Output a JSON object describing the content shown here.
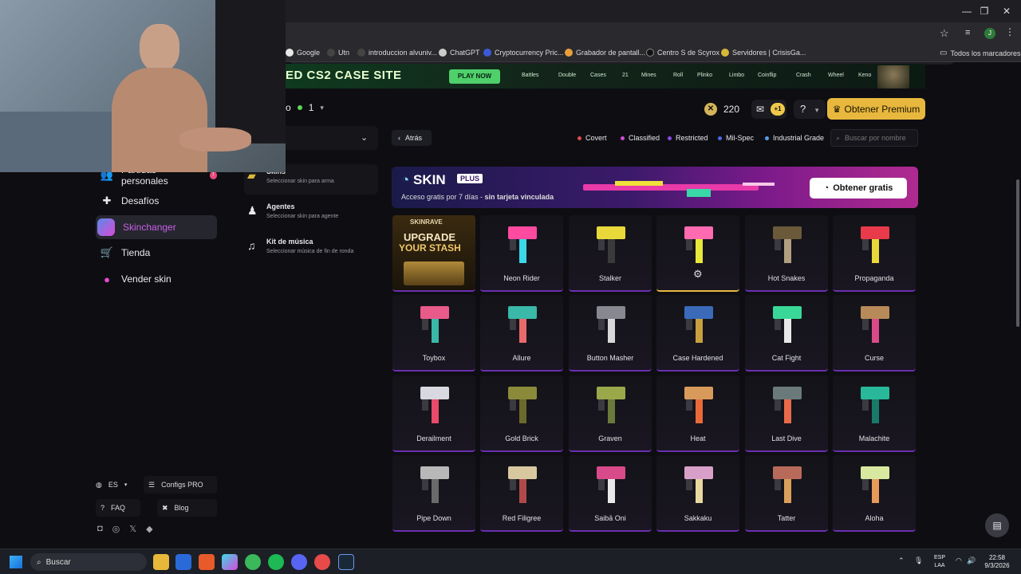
{
  "browser": {
    "bookmarks": [
      "Google",
      "Utn",
      "introduccion alvuniv...",
      "ChatGPT",
      "Cryptocurrency Pric...",
      "Grabador de pantall...",
      "Centro S de Scyrox",
      "Servidores | CrisisGa..."
    ],
    "all_bookmarks_label": "Todos los marcadores",
    "profile_initial": "J"
  },
  "promo_banner": {
    "title": "ED CS2 CASE SITE",
    "button": "PLAY NOW",
    "modes": [
      "Battles",
      "Double",
      "Cases",
      "21",
      "Mines",
      "Roll",
      "Plinko",
      "Limbo",
      "Coinflip",
      "Crash",
      "Wheel",
      "Keno"
    ]
  },
  "header": {
    "level_prefix": "o",
    "level": "1",
    "coins": "220",
    "inbox_badge": "+1",
    "help_label": "?",
    "premium_button": "Obtener Premium"
  },
  "sidebar": {
    "items": [
      {
        "label": "Partidas personales",
        "badge": "!"
      },
      {
        "label": "Desafíos"
      },
      {
        "label": "Skinchanger"
      },
      {
        "label": "Tienda"
      },
      {
        "label": "Vender skin"
      }
    ],
    "language": "ES",
    "configs": "Configs PRO",
    "faq": "FAQ",
    "blog": "Blog"
  },
  "subnav": {
    "items": [
      {
        "title": "Skins",
        "desc": "Seleccionar skin para arma"
      },
      {
        "title": "Agentes",
        "desc": "Seleccionar skin para agente"
      },
      {
        "title": "Kit de música",
        "desc": "Seleccionar música de fin de ronda"
      }
    ]
  },
  "filters": {
    "back": "Atrás",
    "rarities": [
      {
        "label": "Covert",
        "color": "#e04a4a"
      },
      {
        "label": "Classified",
        "color": "#d34ad8"
      },
      {
        "label": "Restricted",
        "color": "#8a4ae8"
      },
      {
        "label": "Mil-Spec",
        "color": "#4a6ae8"
      },
      {
        "label": "Industrial Grade",
        "color": "#5a9ae8"
      }
    ],
    "search_placeholder": "Buscar por nombre"
  },
  "skinplus": {
    "logo": "SKIN",
    "logo_badge": "PLUS",
    "text_a": "Acceso gratis por 7 días - ",
    "text_b": "sin tarjeta vinculada",
    "button": "Obtener gratis"
  },
  "ad_card": {
    "brand": "SKINRAVE",
    "line1": "UPGRADE",
    "line2": "YOUR STASH"
  },
  "skins": [
    {
      "name": "Neon Rider",
      "c1": "#ff4aa0",
      "c2": "#3ad8e8"
    },
    {
      "name": "Stalker",
      "c1": "#e8d83a",
      "c2": "#3a3a3a"
    },
    {
      "name": "",
      "c1": "#ff6ab0",
      "c2": "#e8e83a"
    },
    {
      "name": "Hot Snakes",
      "c1": "#6a5a3a",
      "c2": "#b0a080"
    },
    {
      "name": "Propaganda",
      "c1": "#e83a4a",
      "c2": "#e8d83a"
    },
    {
      "name": "Toybox",
      "c1": "#e85a8a",
      "c2": "#3ab8a8"
    },
    {
      "name": "Allure",
      "c1": "#3ab8a8",
      "c2": "#e86a6a"
    },
    {
      "name": "Button Masher",
      "c1": "#888890",
      "c2": "#d8d8d8"
    },
    {
      "name": "Case Hardened",
      "c1": "#3a6ab8",
      "c2": "#c8a040"
    },
    {
      "name": "Cat Fight",
      "c1": "#3ad898",
      "c2": "#e8e8e8"
    },
    {
      "name": "Curse",
      "c1": "#b88a5a",
      "c2": "#d84a8a"
    },
    {
      "name": "Derailment",
      "c1": "#d8d8e0",
      "c2": "#e84a6a"
    },
    {
      "name": "Gold Brick",
      "c1": "#8a8a3a",
      "c2": "#6a6a2a"
    },
    {
      "name": "Graven",
      "c1": "#9aa84a",
      "c2": "#6a7a3a"
    },
    {
      "name": "Heat",
      "c1": "#d89a5a",
      "c2": "#e86a3a"
    },
    {
      "name": "Last Dive",
      "c1": "#6a7a7a",
      "c2": "#e86a4a"
    },
    {
      "name": "Malachite",
      "c1": "#2ab89a",
      "c2": "#1a7a6a"
    },
    {
      "name": "Pipe Down",
      "c1": "#b8b8b8",
      "c2": "#6a6a6a"
    },
    {
      "name": "Red Filigree",
      "c1": "#d8c8a0",
      "c2": "#b04a4a"
    },
    {
      "name": "Saibā Oni",
      "c1": "#d84a8a",
      "c2": "#e8e8e8"
    },
    {
      "name": "Sakkaku",
      "c1": "#d8a0c8",
      "c2": "#e8d8a0"
    },
    {
      "name": "Tatter",
      "c1": "#b86a5a",
      "c2": "#d8a05a"
    },
    {
      "name": "Aloha",
      "c1": "#d8e8a0",
      "c2": "#e89a5a"
    }
  ],
  "taskbar": {
    "search": "Buscar",
    "lang_line1": "ESP",
    "lang_line2": "LAA",
    "time": "22:58",
    "date": "9/3/2026"
  },
  "colors": {
    "accent": "#e8b83e",
    "active": "#c860e8",
    "rarity_border": "#6a2fb0"
  }
}
